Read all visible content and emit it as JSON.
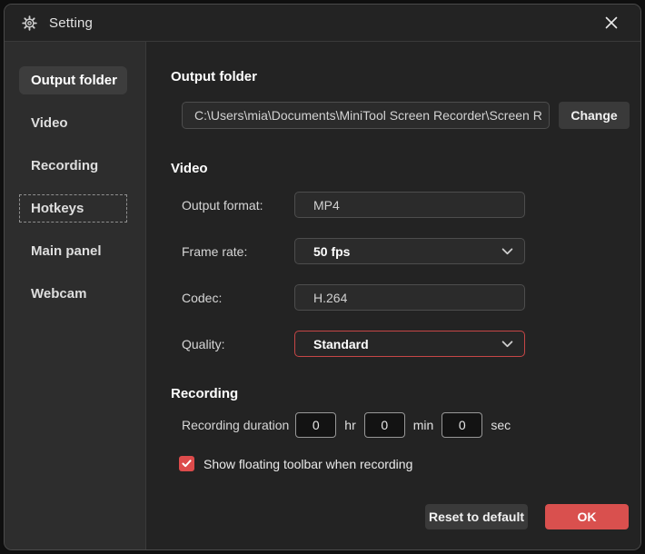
{
  "window": {
    "title": "Setting"
  },
  "sidebar": {
    "items": [
      {
        "label": "Output folder",
        "selected": true
      },
      {
        "label": "Video",
        "selected": false
      },
      {
        "label": "Recording",
        "selected": false
      },
      {
        "label": "Hotkeys",
        "selected": false,
        "focused": true
      },
      {
        "label": "Main panel",
        "selected": false
      },
      {
        "label": "Webcam",
        "selected": false
      }
    ]
  },
  "output_folder_section": {
    "heading": "Output folder",
    "path_value": "C:\\Users\\mia\\Documents\\MiniTool Screen Recorder\\Screen R",
    "change_label": "Change"
  },
  "video_section": {
    "heading": "Video",
    "rows": [
      {
        "label": "Output format:",
        "value": "MP4",
        "type": "input"
      },
      {
        "label": "Frame rate:",
        "value": "50 fps",
        "type": "dropdown"
      },
      {
        "label": "Codec:",
        "value": "H.264",
        "type": "input"
      },
      {
        "label": "Quality:",
        "value": "Standard",
        "type": "dropdown",
        "highlighted": true
      }
    ]
  },
  "recording_section": {
    "heading": "Recording",
    "duration_label": "Recording duration",
    "hours": "0",
    "hr_unit": "hr",
    "minutes": "0",
    "min_unit": "min",
    "seconds": "0",
    "sec_unit": "sec",
    "checkbox_checked": true,
    "checkbox_label": "Show floating toolbar when recording"
  },
  "footer": {
    "reset_label": "Reset to default",
    "ok_label": "OK"
  },
  "colors": {
    "accent_red": "#d9504e",
    "checkbox_red": "#dd4b4b",
    "quality_border_red": "#c64646",
    "dialog_bg": "#232323",
    "sidebar_bg": "#2d2d2d"
  }
}
